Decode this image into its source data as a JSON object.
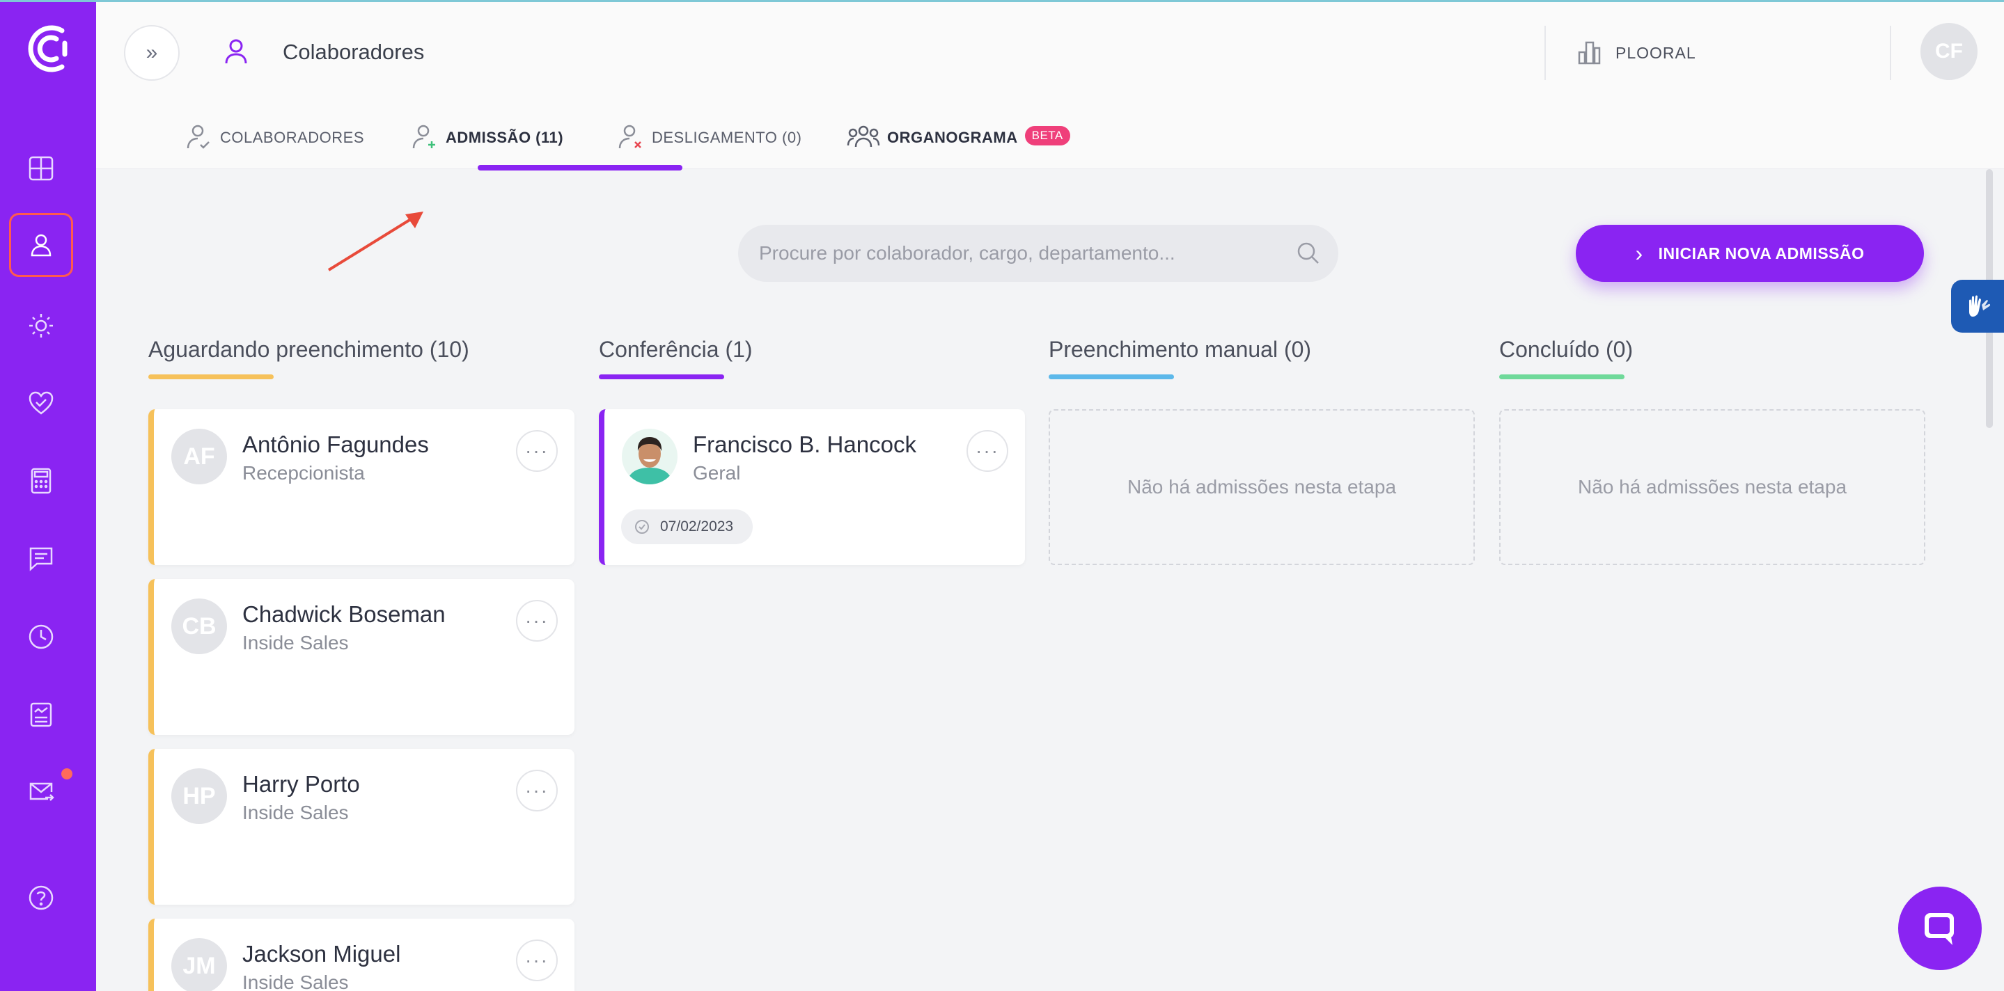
{
  "app": {
    "logo_icon": "company-logo",
    "accent_color": "#8a24f2"
  },
  "sidebar": {
    "items": [
      {
        "icon": "dashboard-grid-icon"
      },
      {
        "icon": "user-icon",
        "active": true
      },
      {
        "icon": "sun-icon"
      },
      {
        "icon": "heart-icon"
      },
      {
        "icon": "calculator-icon"
      },
      {
        "icon": "chat-icon"
      },
      {
        "icon": "clock-icon"
      },
      {
        "icon": "report-icon"
      },
      {
        "icon": "mail-icon",
        "notification": true
      },
      {
        "icon": "help-icon"
      }
    ]
  },
  "header": {
    "expand_label": "»",
    "title": "Colaboradores",
    "company": "PLOORAL",
    "user_initials": "CF"
  },
  "tabs": [
    {
      "label": "COLABORADORES",
      "icon": "user-check-icon"
    },
    {
      "label": "ADMISSÃO (11)",
      "icon": "user-plus-icon",
      "active": true
    },
    {
      "label": "DESLIGAMENTO (0)",
      "icon": "user-x-icon"
    },
    {
      "label": "ORGANOGRAMA",
      "icon": "team-icon",
      "badge": "BETA"
    }
  ],
  "search": {
    "placeholder": "Procure por colaborador, cargo, departamento...",
    "value": ""
  },
  "new_admission_button": {
    "label": "INICIAR NOVA ADMISSÃO"
  },
  "columns": [
    {
      "title": "Aguardando preenchimento (10)",
      "color": "#f6c15a"
    },
    {
      "title": "Conferência (1)",
      "color": "#8a24f2"
    },
    {
      "title": "Preenchimento manual (0)",
      "color": "#5cb8ea",
      "empty_text": "Não há admissões nesta etapa"
    },
    {
      "title": "Concluído (0)",
      "color": "#6fd99a",
      "empty_text": "Não há admissões nesta etapa"
    }
  ],
  "awaiting_cards": [
    {
      "initials": "AF",
      "name": "Antônio Fagundes",
      "role": "Recepcionista"
    },
    {
      "initials": "CB",
      "name": "Chadwick Boseman",
      "role": "Inside Sales"
    },
    {
      "initials": "HP",
      "name": "Harry Porto",
      "role": "Inside Sales"
    },
    {
      "initials": "JM",
      "name": "Jackson Miguel",
      "role": "Inside Sales"
    }
  ],
  "conference_cards": [
    {
      "name": "Francisco B. Hancock",
      "role": "Geral",
      "date": "07/02/2023"
    }
  ],
  "more_label": "···"
}
